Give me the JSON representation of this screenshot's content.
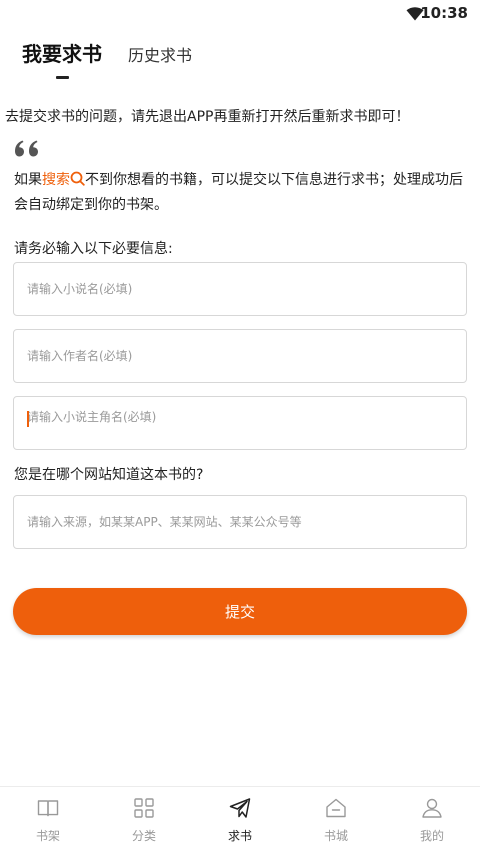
{
  "status_bar": {
    "time": "10:38"
  },
  "tabs": [
    {
      "label": "我要求书",
      "active": true
    },
    {
      "label": "历史求书",
      "active": false
    }
  ],
  "notice": "去提交求书的问题，请先退出APP再重新打开然后重新求书即可！",
  "intro": {
    "prefix": "如果",
    "highlight": "搜索",
    "suffix": "不到你想看的书籍，可以提交以下信息进行求书；处理成功后会自动绑定到你的书架。"
  },
  "required_label": "请务必输入以下必要信息:",
  "fields": {
    "novel_name": {
      "placeholder": "请输入小说名(必填)",
      "value": ""
    },
    "author_name": {
      "placeholder": "请输入作者名(必填)",
      "value": ""
    },
    "protagonist_name": {
      "placeholder": "请输入小说主角名(必填)",
      "value": ""
    },
    "source": {
      "placeholder": "请输入来源，如某某APP、某某网站、某某公众号等",
      "value": ""
    }
  },
  "source_label": "您是在哪个网站知道这本书的?",
  "submit_label": "提交",
  "bottom_nav": [
    {
      "label": "书架",
      "icon": "book-icon",
      "active": false
    },
    {
      "label": "分类",
      "icon": "grid-icon",
      "active": false
    },
    {
      "label": "求书",
      "icon": "paper-plane-icon",
      "active": true
    },
    {
      "label": "书城",
      "icon": "store-icon",
      "active": false
    },
    {
      "label": "我的",
      "icon": "user-icon",
      "active": false
    }
  ],
  "colors": {
    "accent": "#ee5f0c",
    "text": "#222222",
    "muted": "#9a9a9a",
    "border": "#d7d7d7"
  }
}
